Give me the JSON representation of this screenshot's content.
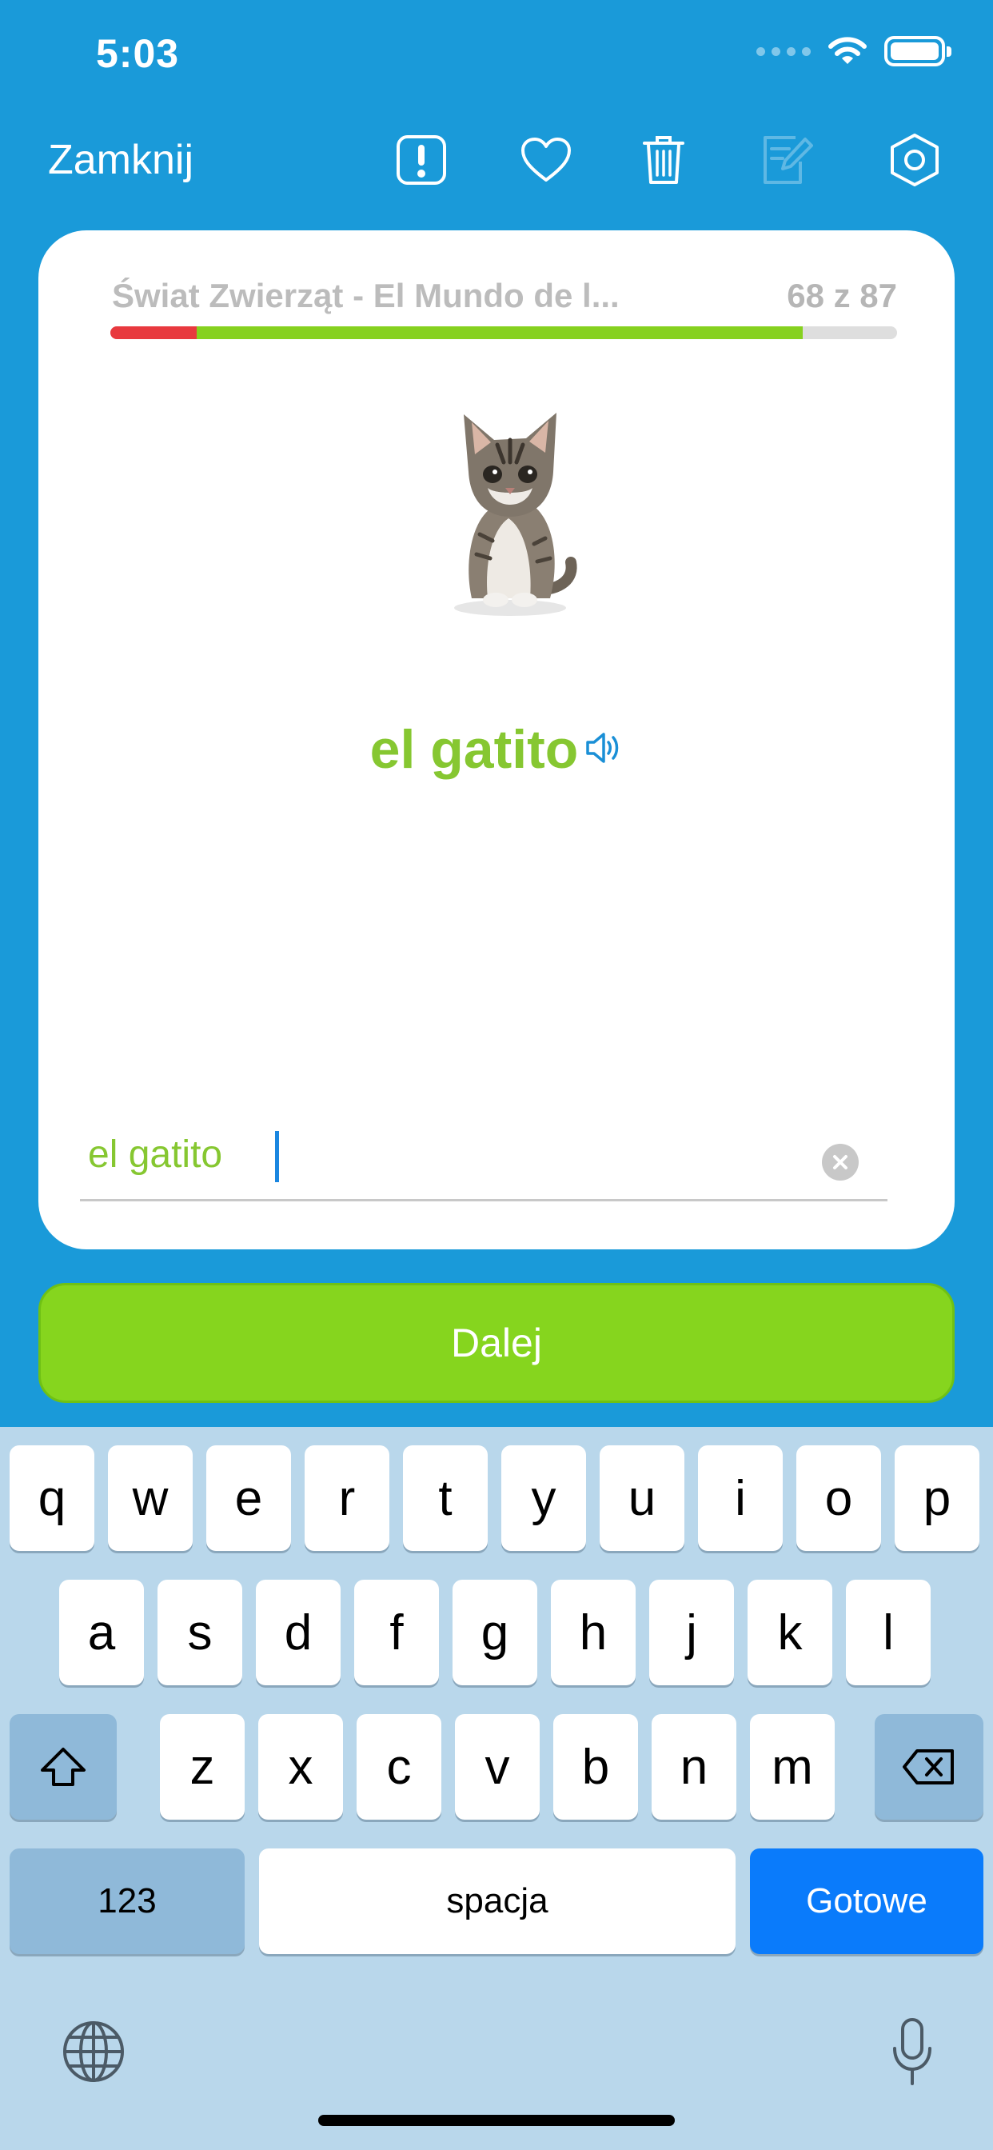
{
  "status": {
    "time": "5:03"
  },
  "toolbar": {
    "close_label": "Zamknij",
    "icons": [
      "report-icon",
      "heart-icon",
      "trash-icon",
      "edit-icon",
      "settings-icon"
    ]
  },
  "card": {
    "deck_title": "Świat Zwierząt - El Mundo de l...",
    "counter": "68 z 87",
    "progress": {
      "wrong_fraction": 0.11,
      "correct_fraction": 0.77
    },
    "word": "el gatito",
    "answer": "el gatito"
  },
  "next_label": "Dalej",
  "keyboard": {
    "row1": [
      "q",
      "w",
      "e",
      "r",
      "t",
      "y",
      "u",
      "i",
      "o",
      "p"
    ],
    "row2": [
      "a",
      "s",
      "d",
      "f",
      "g",
      "h",
      "j",
      "k",
      "l"
    ],
    "row3": [
      "z",
      "x",
      "c",
      "v",
      "b",
      "n",
      "m"
    ],
    "numbers_label": "123",
    "space_label": "spacja",
    "done_label": "Gotowe"
  },
  "colors": {
    "background": "#1a9ad9",
    "accent_green": "#86d51e",
    "word_green": "#86c731",
    "wrong_red": "#e8393e",
    "done_blue": "#0a7bfb"
  }
}
